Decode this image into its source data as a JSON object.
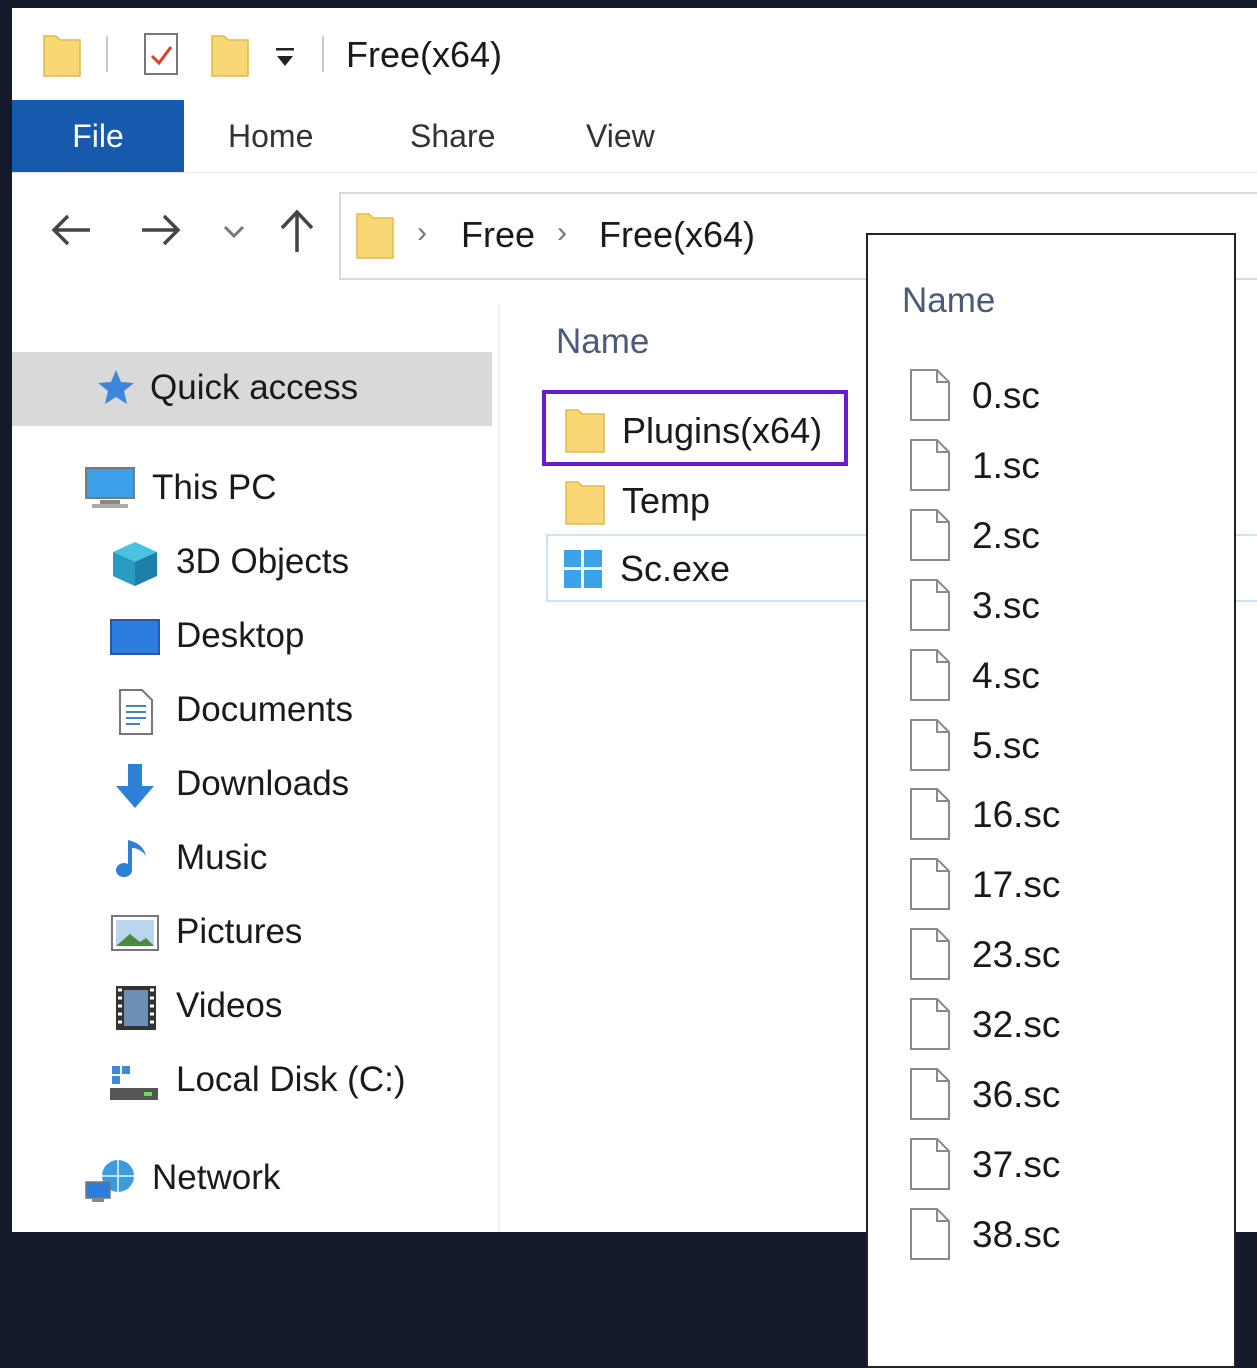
{
  "window": {
    "title": "Free(x64)"
  },
  "ribbon": {
    "tabs": [
      "File",
      "Home",
      "Share",
      "View"
    ]
  },
  "address": {
    "crumbs": [
      "Free",
      "Free(x64)"
    ]
  },
  "sidebar": {
    "quick_access": "Quick access",
    "this_pc": "This PC",
    "items": [
      "3D Objects",
      "Desktop",
      "Documents",
      "Downloads",
      "Music",
      "Pictures",
      "Videos",
      "Local Disk (C:)"
    ],
    "network": "Network"
  },
  "main": {
    "column_header": "Name",
    "items": [
      {
        "name": "Plugins(x64)",
        "icon": "folder-icon"
      },
      {
        "name": "Temp",
        "icon": "folder-icon"
      },
      {
        "name": "Sc.exe",
        "icon": "windows-app-icon"
      }
    ]
  },
  "overlay": {
    "column_header": "Name",
    "files": [
      "0.sc",
      "1.sc",
      "2.sc",
      "3.sc",
      "4.sc",
      "5.sc",
      "16.sc",
      "17.sc",
      "23.sc",
      "32.sc",
      "36.sc",
      "37.sc",
      "38.sc"
    ]
  },
  "colors": {
    "file_tab": "#1659ad",
    "highlight": "#6a1bd0",
    "folder": "#f8d775"
  }
}
